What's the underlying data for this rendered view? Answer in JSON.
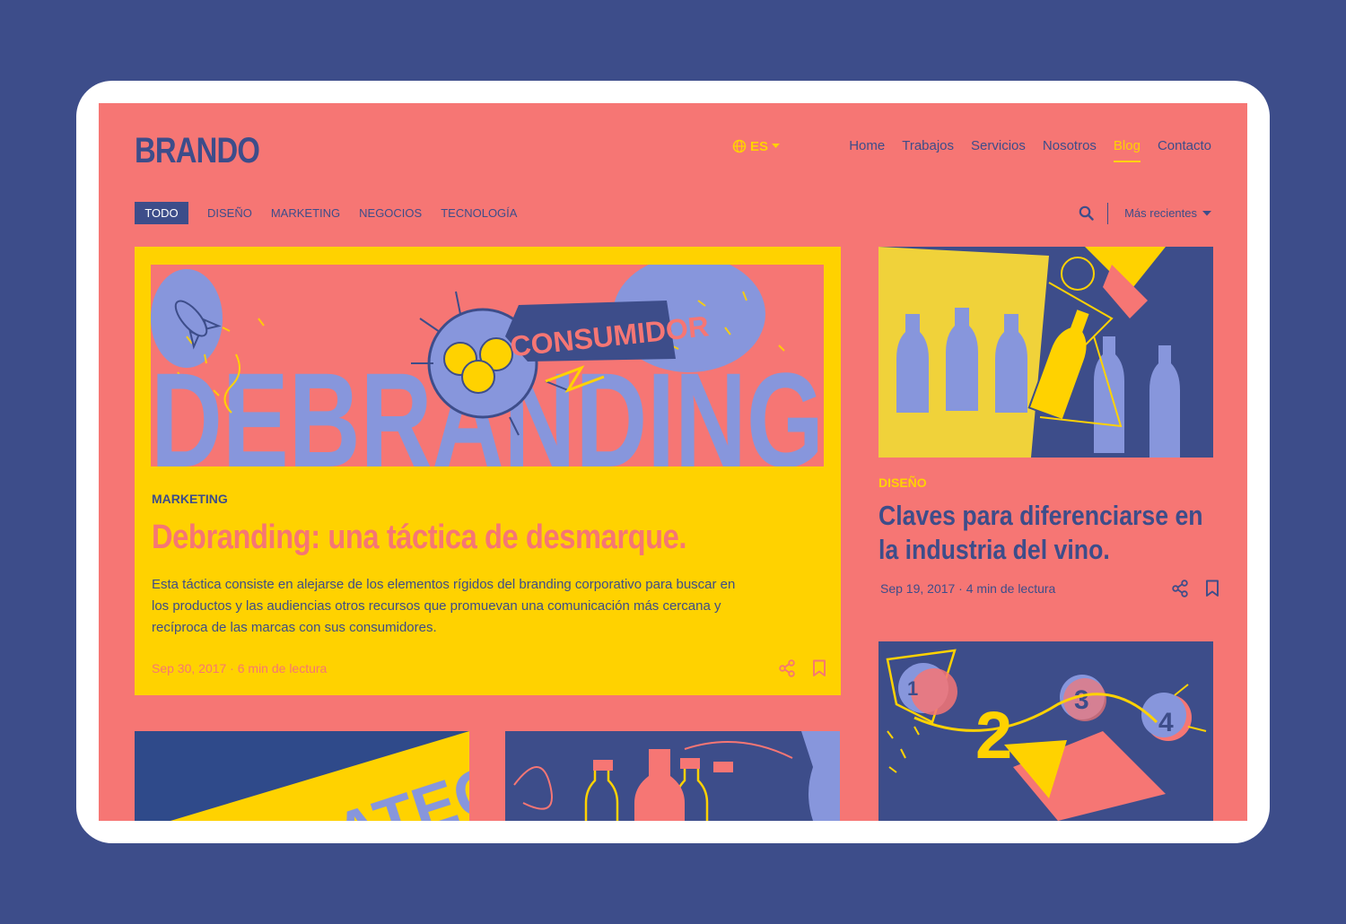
{
  "brand": {
    "logo_text": "BRANDO"
  },
  "language": {
    "code": "ES"
  },
  "nav": {
    "items": [
      {
        "label": "Home"
      },
      {
        "label": "Trabajos"
      },
      {
        "label": "Servicios"
      },
      {
        "label": "Nosotros"
      },
      {
        "label": "Blog",
        "active": true
      },
      {
        "label": "Contacto"
      }
    ]
  },
  "filters": {
    "items": [
      {
        "label": "TODO",
        "active": true
      },
      {
        "label": "DISEÑO"
      },
      {
        "label": "MARKETING"
      },
      {
        "label": "NEGOCIOS"
      },
      {
        "label": "TECNOLOGÍA"
      }
    ]
  },
  "tools": {
    "sort_label": "Más recientes"
  },
  "featured": {
    "image_words": [
      "DEBRANDING",
      "CONSUMIDOR"
    ],
    "category": "MARKETING",
    "title": "Debranding: una táctica de desmarque.",
    "excerpt": "Esta táctica consiste en alejarse de los elementos rígidos del branding corporativo para buscar en los productos y las audiencias otros recursos que promuevan una comunicación más cercana y recíproca de las marcas con sus consumidores.",
    "meta": "Sep 30, 2017 · 6 min de lectura"
  },
  "side_article": {
    "category": "DISEÑO",
    "title": "Claves para diferenciarse en la industria del vino.",
    "meta": "Sep 19, 2017 · 4 min de lectura"
  },
  "side_article_2": {
    "image_numbers": [
      "1",
      "2",
      "3",
      "4"
    ]
  },
  "bottom_card_1": {
    "image_word": "ESTRATEGIA"
  },
  "colors": {
    "background": "#3d4d8a",
    "screen": "#f67674",
    "accent": "#ffd200",
    "navy": "#3d4d8a",
    "periwinkle": "#8796dc"
  },
  "icons": {
    "globe": "globe-icon",
    "caret": "caret-down-icon",
    "search": "search-icon",
    "share": "share-icon",
    "bookmark": "bookmark-icon"
  }
}
